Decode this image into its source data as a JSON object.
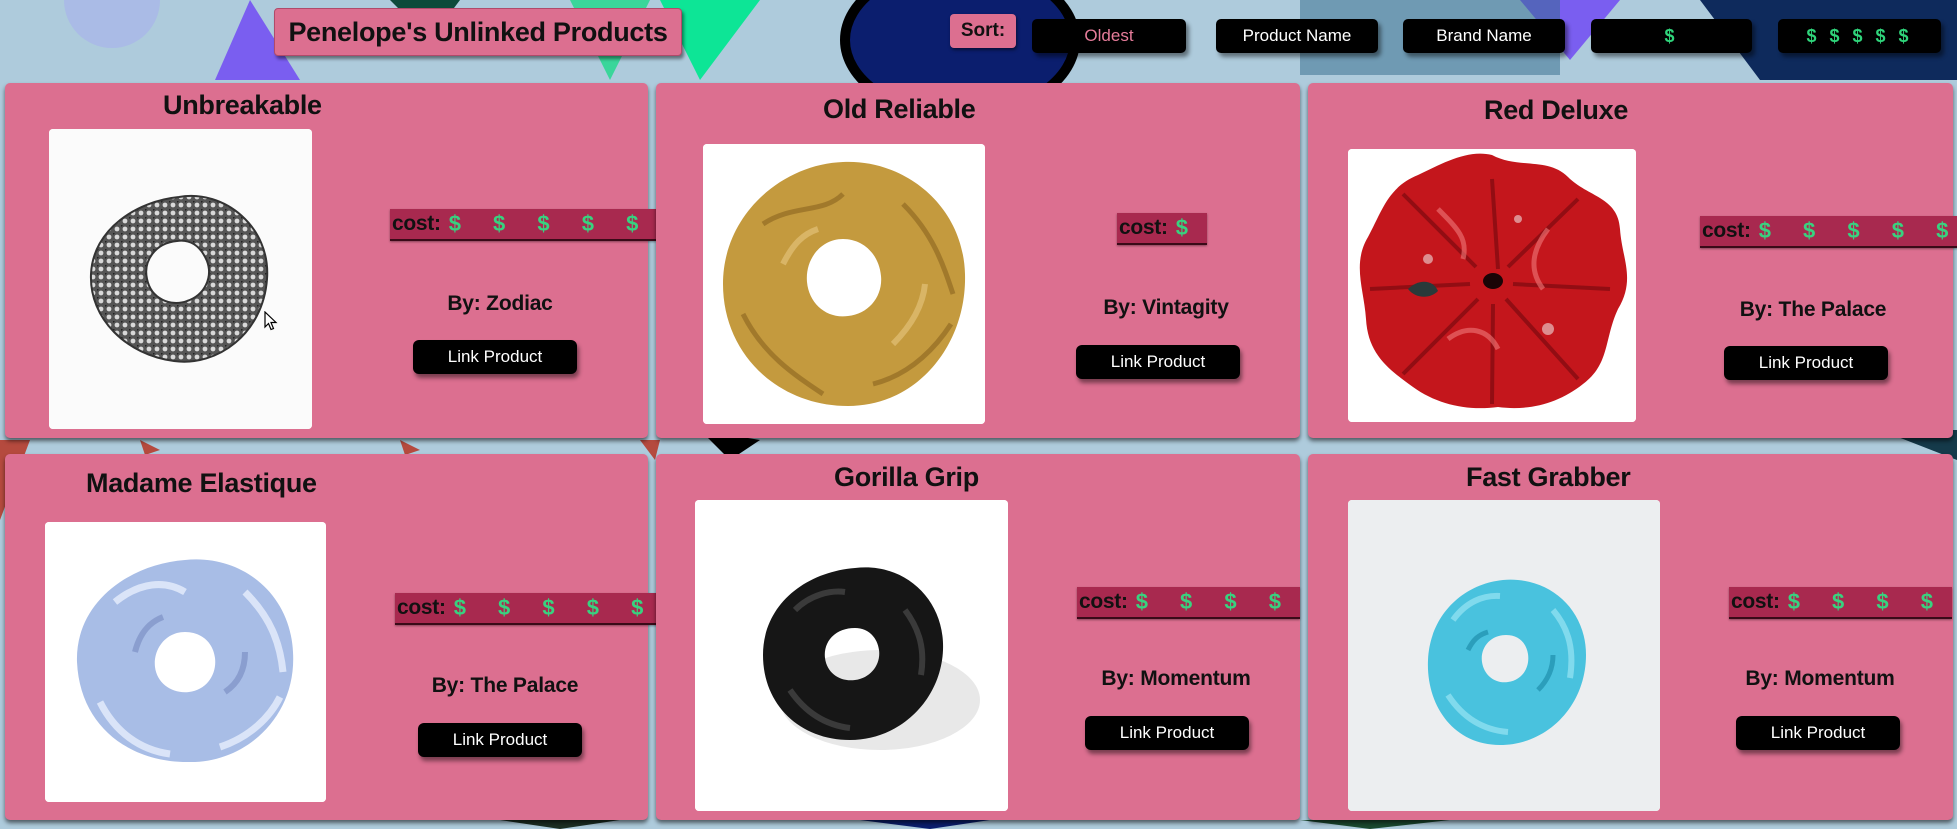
{
  "page": {
    "title": "Penelope's Unlinked Products"
  },
  "sort": {
    "label": "Sort:",
    "options": [
      "Oldest",
      "Product Name",
      "Brand Name",
      "$",
      "$ $ $ $ $"
    ],
    "active": "Oldest"
  },
  "colors": {
    "background": "#aecbdc",
    "card": "#dc6f90",
    "cost_band": "#a8294f",
    "dollar": "#38d27f",
    "button": "#000000"
  },
  "products": [
    {
      "title": "Unbreakable",
      "cost_label": "cost:",
      "cost": "$ $ $ $ $",
      "cost_level": 5,
      "brand": "By: Zodiac",
      "button": "Link Product",
      "image": "gray-chainmail-scrunchie-photo"
    },
    {
      "title": "Old Reliable",
      "cost_label": "cost:",
      "cost": "$",
      "cost_level": 1,
      "brand": "By: Vintagity",
      "button": "Link Product",
      "image": "gold-velvet-scrunchie-photo"
    },
    {
      "title": "Red Deluxe",
      "cost_label": "cost:",
      "cost": "$ $ $ $ $",
      "cost_level": 5,
      "brand": "By: The Palace",
      "button": "Link Product",
      "image": "red-silk-scrunchie-photo"
    },
    {
      "title": "Madame Elastique",
      "cost_label": "cost:",
      "cost": "$ $ $ $ $",
      "cost_level": 5,
      "brand": "By: The Palace",
      "button": "Link Product",
      "image": "light-blue-satin-scrunchie-photo"
    },
    {
      "title": "Gorilla Grip",
      "cost_label": "cost:",
      "cost": "$ $ $ $",
      "cost_level": 4,
      "brand": "By: Momentum",
      "button": "Link Product",
      "image": "black-scrunchie-photo"
    },
    {
      "title": "Fast Grabber",
      "cost_label": "cost:",
      "cost": "$ $ $ $",
      "cost_level": 4,
      "brand": "By: Momentum",
      "button": "Link Product",
      "image": "turquoise-scrunchie-photo"
    }
  ]
}
